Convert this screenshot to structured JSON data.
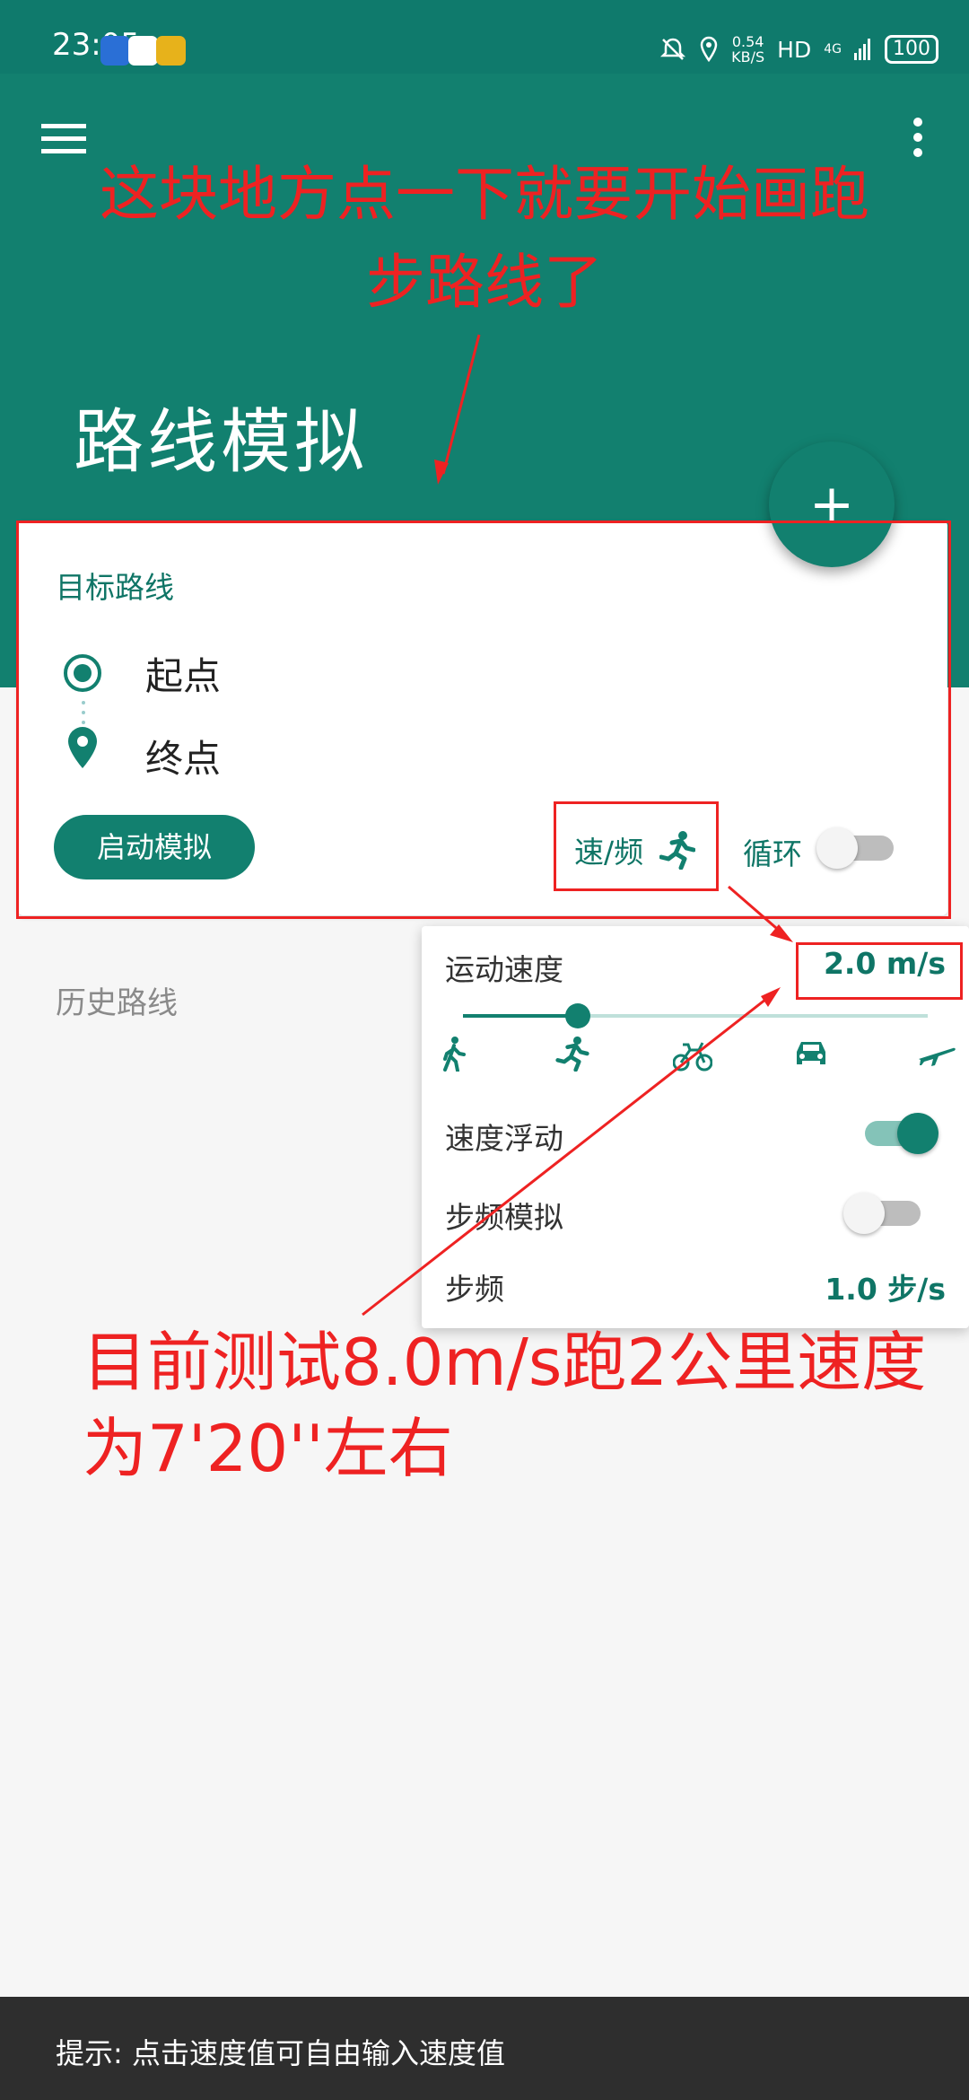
{
  "status_bar": {
    "time": "23:05",
    "net_speed_value": "0.54",
    "net_speed_unit": "KB/S",
    "hd": "HD",
    "signal": "4G",
    "battery": "100"
  },
  "header": {
    "title": "路线模拟",
    "menu_icon": "hamburger-menu-icon",
    "more_icon": "more-vertical-icon",
    "fab_icon": "+"
  },
  "route_card": {
    "target_label": "目标路线",
    "start_label": "起点",
    "end_label": "终点",
    "start_button": "启动模拟",
    "speed_freq_label": "速/频",
    "loop_label": "循环",
    "loop_enabled": false
  },
  "history": {
    "label": "历史路线"
  },
  "speed_popup": {
    "title": "运动速度",
    "value": "2.0  m/s",
    "slider_position": 0.25,
    "modes": [
      "walk-icon",
      "run-icon",
      "bike-icon",
      "car-icon",
      "plane-icon"
    ],
    "float_label": "速度浮动",
    "float_enabled": true,
    "cadence_sim_label": "步频模拟",
    "cadence_sim_enabled": false,
    "cadence_label": "步频",
    "cadence_value": "1.0  步/s"
  },
  "annotations": {
    "top_text": "这块地方点一下就要开始画跑步路线了",
    "bottom_text": "目前测试8.0m/s跑2公里速度为7'20''左右",
    "color": "#ee2222"
  },
  "toast": {
    "text": "提示: 点击速度值可自由输入速度值"
  },
  "colors": {
    "primary": "#12806f",
    "status_bar": "#0f7a6c",
    "accent_text": "#0f7566"
  }
}
